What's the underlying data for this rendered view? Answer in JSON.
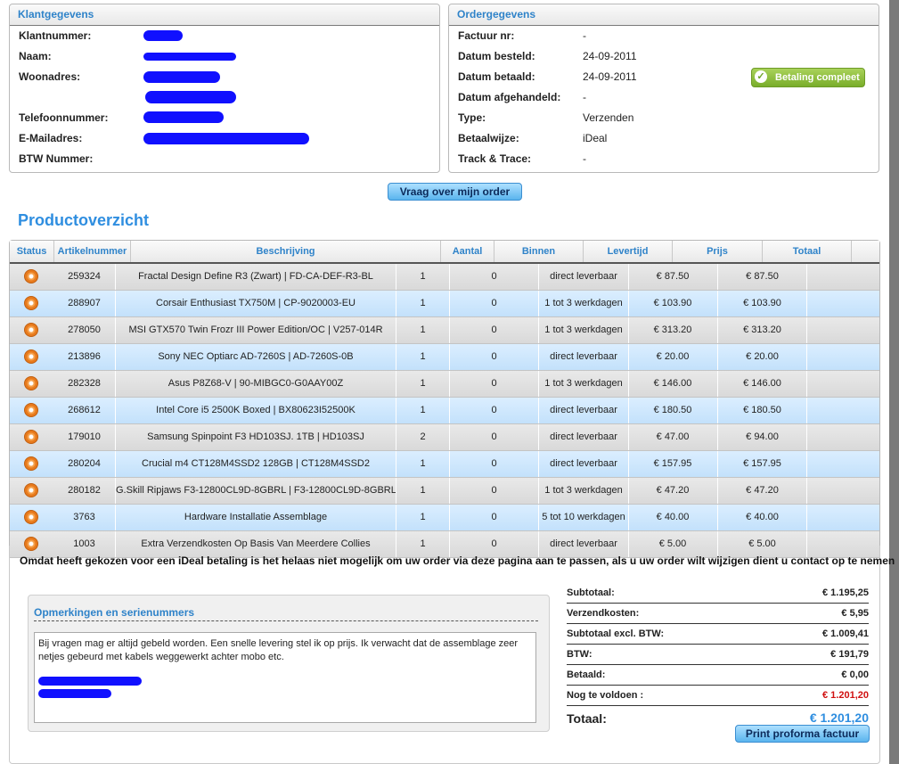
{
  "customer": {
    "title": "Klantgegevens",
    "fields": [
      {
        "label": "Klantnummer:",
        "value": ""
      },
      {
        "label": "Naam:",
        "value": ""
      },
      {
        "label": "Woonadres:",
        "value": ""
      },
      {
        "label": "",
        "value": ""
      },
      {
        "label": "Telefoonnummer:",
        "value": ""
      },
      {
        "label": "E-Mailadres:",
        "value": ""
      },
      {
        "label": "BTW Nummer:",
        "value": ""
      }
    ]
  },
  "order": {
    "title": "Ordergegevens",
    "fields": [
      {
        "label": "Factuur nr:",
        "value": "-"
      },
      {
        "label": "Datum besteld:",
        "value": "24-09-2011"
      },
      {
        "label": "Datum betaald:",
        "value": "24-09-2011"
      },
      {
        "label": "Datum afgehandeld:",
        "value": "-"
      },
      {
        "label": "Type:",
        "value": "Verzenden"
      },
      {
        "label": "Betaalwijze:",
        "value": "iDeal"
      },
      {
        "label": "Track & Trace:",
        "value": "-"
      }
    ],
    "badge": "Betaling compleet"
  },
  "ask_button": "Vraag over mijn order",
  "products": {
    "title": "Productoverzicht",
    "columns": [
      "Status",
      "Artikelnummer",
      "Beschrijving",
      "Aantal",
      "Binnen",
      "Levertijd",
      "Prijs",
      "Totaal"
    ],
    "rows": [
      [
        "259324",
        "Fractal Design Define R3 (Zwart) | FD-CA-DEF-R3-BL",
        "1",
        "0",
        "direct leverbaar",
        "€ 87.50",
        "€ 87.50"
      ],
      [
        "288907",
        "Corsair Enthusiast TX750M | CP-9020003-EU",
        "1",
        "0",
        "1 tot 3 werkdagen",
        "€ 103.90",
        "€ 103.90"
      ],
      [
        "278050",
        "MSI GTX570 Twin Frozr III Power Edition/OC | V257-014R",
        "1",
        "0",
        "1 tot 3 werkdagen",
        "€ 313.20",
        "€ 313.20"
      ],
      [
        "213896",
        "Sony NEC Optiarc AD-7260S | AD-7260S-0B",
        "1",
        "0",
        "direct leverbaar",
        "€ 20.00",
        "€ 20.00"
      ],
      [
        "282328",
        "Asus P8Z68-V | 90-MIBGC0-G0AAY00Z",
        "1",
        "0",
        "1 tot 3 werkdagen",
        "€ 146.00",
        "€ 146.00"
      ],
      [
        "268612",
        "Intel Core i5 2500K Boxed | BX80623I52500K",
        "1",
        "0",
        "direct leverbaar",
        "€ 180.50",
        "€ 180.50"
      ],
      [
        "179010",
        "Samsung Spinpoint F3 HD103SJ. 1TB | HD103SJ",
        "2",
        "0",
        "direct leverbaar",
        "€ 47.00",
        "€ 94.00"
      ],
      [
        "280204",
        "Crucial m4 CT128M4SSD2 128GB | CT128M4SSD2",
        "1",
        "0",
        "direct leverbaar",
        "€ 157.95",
        "€ 157.95"
      ],
      [
        "280182",
        "G.Skill Ripjaws F3-12800CL9D-8GBRL | F3-12800CL9D-8GBRL",
        "1",
        "0",
        "1 tot 3 werkdagen",
        "€ 47.20",
        "€ 47.20"
      ],
      [
        "3763",
        "Hardware Installatie Assemblage",
        "1",
        "0",
        "5 tot 10 werkdagen",
        "€ 40.00",
        "€ 40.00"
      ],
      [
        "1003",
        "Extra Verzendkosten Op Basis Van Meerdere Collies",
        "1",
        "0",
        "direct leverbaar",
        "€ 5.00",
        "€ 5.00"
      ]
    ]
  },
  "notice": "Omdat heeft gekozen voor een iDeal betaling is het helaas niet mogelijk om uw order via deze pagina aan te passen, als u uw order wilt wijzigen dient u contact op te nemen",
  "remarks": {
    "title": "Opmerkingen en serienummers",
    "text": "Bij vragen mag er altijd gebeld worden. Een snelle levering stel ik op prijs. Ik verwacht dat de assemblage zeer netjes gebeurd met kabels weggewerkt achter mobo etc."
  },
  "totals": {
    "rows": [
      {
        "label": "Subtotaal:",
        "value": "€ 1.195,25"
      },
      {
        "label": "Verzendkosten:",
        "value": "€ 5,95"
      },
      {
        "label": "Subtotaal excl. BTW:",
        "value": "€ 1.009,41"
      },
      {
        "label": "BTW:",
        "value": "€ 191,79"
      },
      {
        "label": "Betaald:",
        "value": "€ 0,00"
      },
      {
        "label": "Nog te voldoen :",
        "value": "€ 1.201,20"
      }
    ],
    "total_label": "Totaal:",
    "total_value": "€ 1.201,20"
  },
  "print_button": "Print proforma factuur",
  "colors": {
    "accent": "#2f83c9",
    "danger": "#d01010",
    "success": "#79ad2a"
  }
}
